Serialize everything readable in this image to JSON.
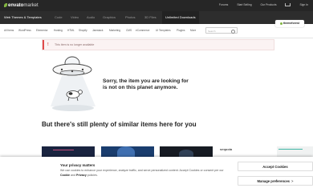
{
  "header": {
    "logo_text": "envato",
    "logo_suffix": "market",
    "links": [
      "Forums",
      "Start Selling",
      "Our Products",
      "Sign In"
    ]
  },
  "categories": [
    {
      "label": "Web Themes & Templates",
      "main": true
    },
    {
      "label": "Code"
    },
    {
      "label": "Video"
    },
    {
      "label": "Audio"
    },
    {
      "label": "Graphics"
    },
    {
      "label": "Photos"
    },
    {
      "label": "3D Files"
    },
    {
      "label": "Unlimited Downloads",
      "active": true
    }
  ],
  "subnav": [
    "All Items",
    "WordPress",
    "Elementor",
    "Hosting",
    "HTML",
    "Shopify",
    "Jamstack",
    "Marketing",
    "CMS",
    "eCommerce",
    "UI Templates",
    "Plugins",
    "More"
  ],
  "search_placeholder": "Search",
  "badge": "themeforest",
  "notice": {
    "icon": "!",
    "text": "This item is no longer available"
  },
  "hero": {
    "line1": "Sorry, the item you are looking for",
    "line2": "is not on this planet anymore."
  },
  "similar_heading": "But there's still plenty of similar items here for you",
  "thumb_label": "sequoia",
  "cookie": {
    "title": "Your privacy matters",
    "body_prefix": "We use cookies to enhance your experience, analyze traffic, and serve personalized content. Accept Cookies or consent per our",
    "cookie_link": "Cookie",
    "and": "and",
    "privacy_link": "Privacy",
    "body_suffix": "policies.",
    "accept_label": "Accept Cookies",
    "manage_label": "Manage preferences",
    "manage_chevron": ">"
  }
}
